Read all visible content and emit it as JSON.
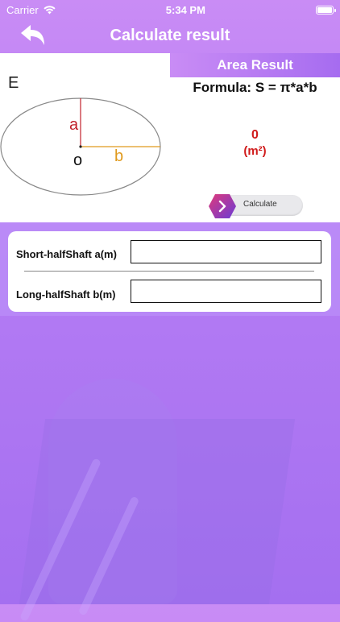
{
  "status_bar": {
    "carrier": "Carrier",
    "time": "5:34 PM"
  },
  "nav": {
    "title": "Calculate result"
  },
  "diagram": {
    "label_e": "E",
    "label_a": "a",
    "label_b": "b",
    "label_o": "o",
    "color_a": "#c0202a",
    "color_b": "#e09a1e"
  },
  "result": {
    "header": "Area Result",
    "formula": "Formula: S = π*a*b",
    "value": "0",
    "unit": "(m²)",
    "calculate_label": "Calculate"
  },
  "inputs": {
    "short_label": "Short-halfShaft a(m)",
    "short_value": "",
    "long_label": "Long-halfShaft b(m)",
    "long_value": ""
  },
  "colors": {
    "accent": "#a66cf0",
    "result": "#d01a1a"
  }
}
